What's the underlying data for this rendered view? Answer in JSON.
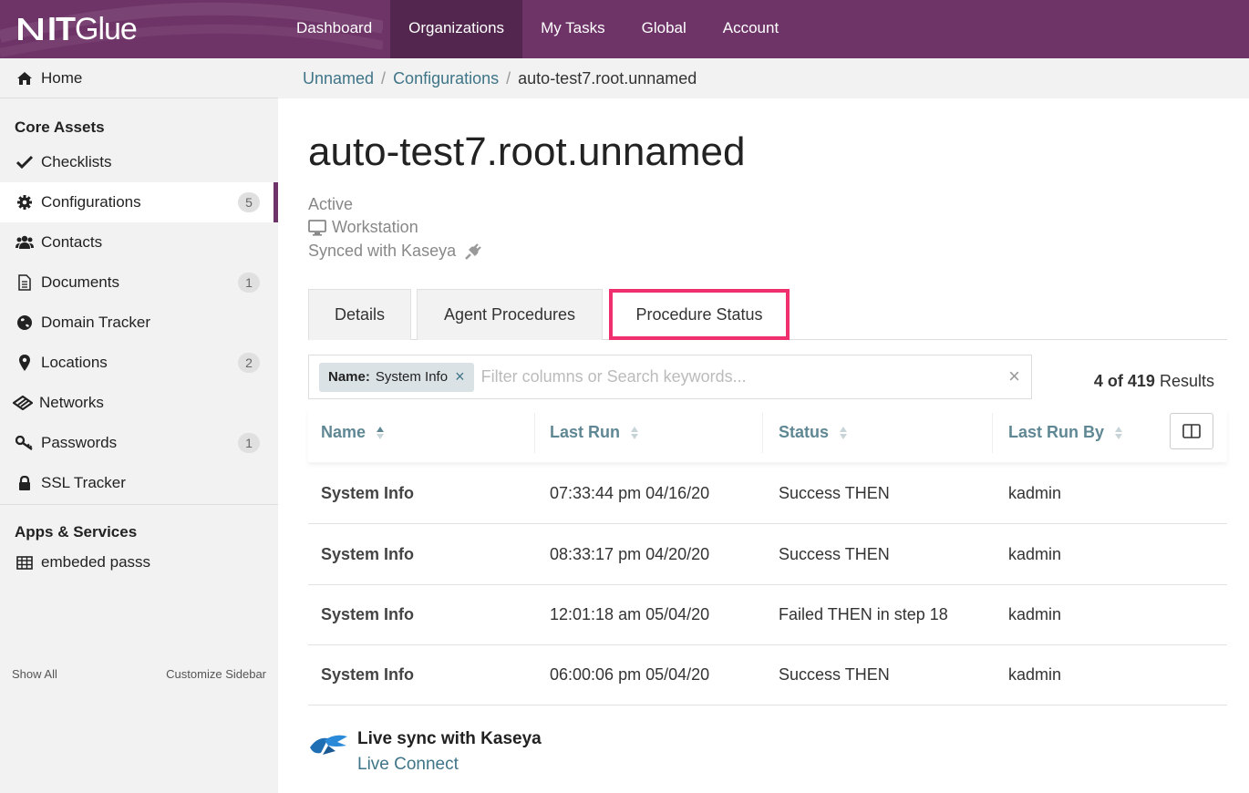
{
  "app": {
    "logo_it": "IT",
    "logo_glue": "Glue"
  },
  "nav": {
    "items": [
      {
        "label": "Dashboard"
      },
      {
        "label": "Organizations"
      },
      {
        "label": "My Tasks"
      },
      {
        "label": "Global"
      },
      {
        "label": "Account"
      }
    ],
    "active": "Organizations"
  },
  "sidebar": {
    "home": "Home",
    "core_heading": "Core Assets",
    "core_items": [
      {
        "label": "Checklists",
        "icon": "check-icon",
        "count": ""
      },
      {
        "label": "Configurations",
        "icon": "gear-icon",
        "count": "5"
      },
      {
        "label": "Contacts",
        "icon": "users-icon",
        "count": ""
      },
      {
        "label": "Documents",
        "icon": "document-icon",
        "count": "1"
      },
      {
        "label": "Domain Tracker",
        "icon": "globe-icon",
        "count": ""
      },
      {
        "label": "Locations",
        "icon": "map-pin-icon",
        "count": "2"
      },
      {
        "label": "Networks",
        "icon": "network-icon",
        "count": ""
      },
      {
        "label": "Passwords",
        "icon": "key-icon",
        "count": "1"
      },
      {
        "label": "SSL Tracker",
        "icon": "lock-icon",
        "count": ""
      }
    ],
    "apps_heading": "Apps & Services",
    "apps_items": [
      {
        "label": "embeded passs",
        "icon": "table-icon"
      }
    ],
    "show_all": "Show All",
    "customize": "Customize Sidebar"
  },
  "breadcrumb": {
    "org": "Unnamed",
    "section": "Configurations",
    "current": "auto-test7.root.unnamed",
    "separator": "/"
  },
  "page": {
    "title": "auto-test7.root.unnamed",
    "status": "Active",
    "type": "Workstation",
    "sync": "Synced with Kaseya"
  },
  "tabs": [
    {
      "label": "Details"
    },
    {
      "label": "Agent Procedures"
    },
    {
      "label": "Procedure Status"
    }
  ],
  "filter": {
    "chip_key": "Name:",
    "chip_value": "System Info",
    "chip_remove": "×",
    "placeholder": "Filter columns or Search keywords...",
    "clear": "×"
  },
  "results": {
    "count": "4 of 419",
    "label": "Results"
  },
  "table": {
    "columns": [
      "Name",
      "Last Run",
      "Status",
      "Last Run By"
    ],
    "rows": [
      {
        "name": "System Info",
        "last_run": "07:33:44 pm 04/16/20",
        "status": "Success THEN",
        "by": "kadmin"
      },
      {
        "name": "System Info",
        "last_run": "08:33:17 pm 04/20/20",
        "status": "Success THEN",
        "by": "kadmin"
      },
      {
        "name": "System Info",
        "last_run": "12:01:18 am 05/04/20",
        "status": "Failed THEN in step 18",
        "by": "kadmin"
      },
      {
        "name": "System Info",
        "last_run": "06:00:06 pm 05/04/20",
        "status": "Success THEN",
        "by": "kadmin"
      }
    ]
  },
  "kaseya": {
    "title": "Live sync with Kaseya",
    "link": "Live Connect"
  },
  "colors": {
    "brand": "#6e3468",
    "brand_dark": "#53264f",
    "link": "#3f7588",
    "highlight": "#f0306e"
  }
}
